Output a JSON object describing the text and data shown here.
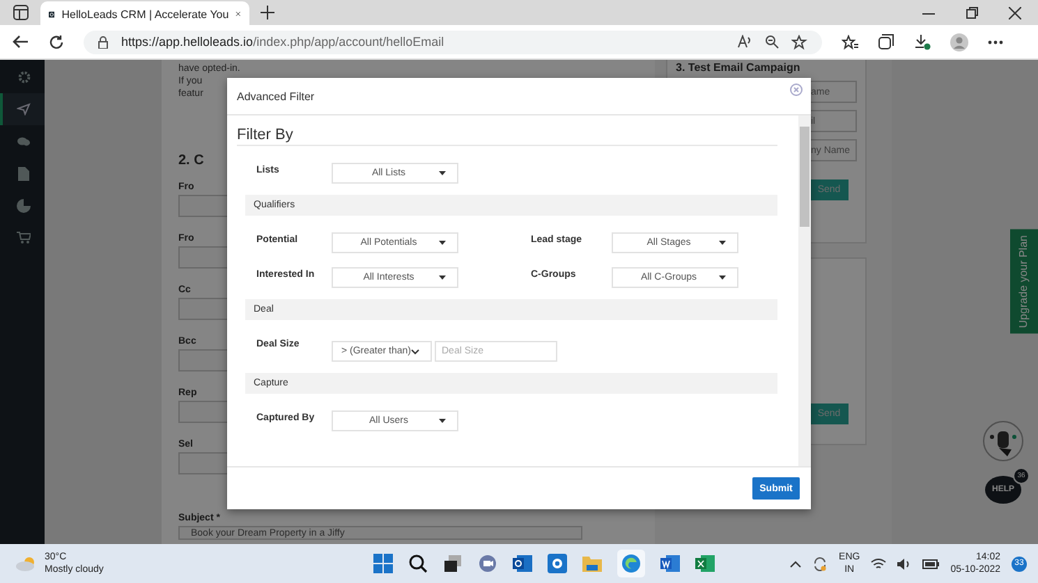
{
  "browser": {
    "tab_title": "HelloLeads CRM | Accelerate You",
    "url_host": "https://app.helloleads.io",
    "url_path": "/index.php/app/account/helloEmail"
  },
  "sidebar": {
    "items": [
      {
        "kind": "gear",
        "selected": false
      },
      {
        "kind": "send",
        "selected": true
      },
      {
        "kind": "chat",
        "selected": false
      },
      {
        "kind": "doc",
        "selected": false
      },
      {
        "kind": "pie",
        "selected": false
      },
      {
        "kind": "cart",
        "selected": false
      }
    ]
  },
  "background": {
    "notes": [
      "have opted-in.",
      "If you",
      "featur"
    ],
    "section_heading": "2. C",
    "field_labels": [
      "Fro",
      "Fro",
      "Cc",
      "Bcc",
      "Rep",
      "Sel"
    ],
    "subject_label": "Subject *",
    "subject_value": "Book your Dream Property in a Jiffy",
    "test_heading": "3. Test Email Campaign",
    "test_fields": [
      "ame",
      "il",
      "ny Name"
    ],
    "send_buttons": [
      "Send",
      "Send"
    ]
  },
  "upgrade_tab": "Upgrade your Plan",
  "help": {
    "label": "HELP",
    "badge": "36"
  },
  "modal": {
    "title": "Advanced Filter",
    "heading": "Filter By",
    "groups": [
      {
        "rows": [
          {
            "label": "Lists",
            "kind": "select",
            "value": "All Lists"
          }
        ]
      },
      {
        "title": "Qualifiers",
        "rows": [
          {
            "label": "Potential",
            "kind": "select",
            "value": "All Potentials"
          },
          {
            "label": "Lead stage",
            "kind": "select",
            "value": "All Stages"
          },
          {
            "label": "Interested In",
            "kind": "select",
            "value": "All Interests"
          },
          {
            "label": "C-Groups",
            "kind": "select",
            "value": "All C-Groups"
          }
        ]
      },
      {
        "title": "Deal",
        "rows": [
          {
            "label": "Deal Size",
            "kind": "compare",
            "value": "> (Greater than)",
            "placeholder": "Deal Size"
          }
        ]
      },
      {
        "title": "Capture",
        "rows": [
          {
            "label": "Captured By",
            "kind": "select",
            "value": "All Users"
          }
        ]
      }
    ],
    "submit": "Submit"
  },
  "taskbar": {
    "temp": "30°C",
    "weather": "Mostly cloudy",
    "lang": [
      "ENG",
      "IN"
    ],
    "time": "14:02",
    "date": "05-10-2022",
    "badge": "33"
  }
}
